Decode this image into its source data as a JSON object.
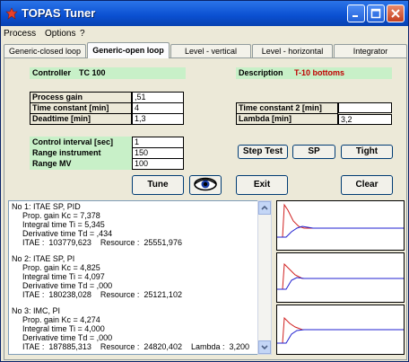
{
  "window": {
    "title": "TOPAS   Tuner"
  },
  "menu": [
    "Process",
    "Options",
    "?"
  ],
  "tabs": [
    "Generic-closed loop",
    "Generic-open loop",
    "Level - vertical",
    "Level - horizontal",
    "Integrator"
  ],
  "controller": {
    "label": "Controller",
    "value": "TC 100"
  },
  "description": {
    "label": "Description",
    "value": "T-10 bottoms"
  },
  "params": {
    "labels": [
      "Process gain",
      "Time constant [min]",
      "Deadtime [min]"
    ],
    "values": [
      ",51",
      "4",
      "1,3"
    ]
  },
  "params2": {
    "labels": [
      "Time constant 2 [min]",
      "Lambda [min]"
    ],
    "values": [
      "",
      "3,2"
    ]
  },
  "control": {
    "labels": [
      "Control interval [sec]",
      "Range instrument",
      "Range MV"
    ],
    "values": [
      "1",
      "150",
      "100"
    ]
  },
  "buttons": {
    "step_test": "Step Test",
    "sp": "SP",
    "tight": "Tight",
    "tune": "Tune",
    "exit": "Exit",
    "clear": "Clear"
  },
  "results": [
    {
      "title": "No 1: ITAE SP, PID",
      "lines": [
        "Prop. gain Kc = 7,378",
        "Integral time Ti = 5,345",
        "Derivative time Td = ,434"
      ],
      "itae": "ITAE :  103779,623    Resource :  25551,976"
    },
    {
      "title": "No 2: ITAE SP, PI",
      "lines": [
        "Prop. gain Kc = 4,825",
        "Integral time Ti = 4,097",
        "Derivative time Td = ,000"
      ],
      "itae": "ITAE :  180238,028    Resource :  25121,102"
    },
    {
      "title": "No 3: IMC, PI",
      "lines": [
        "Prop. gain Kc = 4,274",
        "Integral time Ti = 4,000",
        "Derivative time Td = ,000"
      ],
      "itae": "ITAE :  187885,313    Resource :  24820,402    Lambda :  3,200"
    }
  ],
  "colors": {
    "accent": "#0a4fd1",
    "pv_line": "#d02020",
    "mv_line": "#2020d0"
  }
}
